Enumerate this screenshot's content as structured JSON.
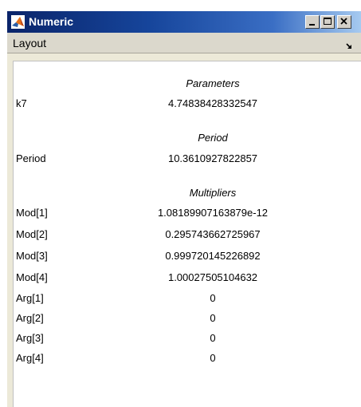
{
  "window": {
    "title": "Numeric"
  },
  "menu": {
    "layout_label": "Layout"
  },
  "sections": {
    "parameters": {
      "heading": "Parameters",
      "rows": [
        {
          "label": "k7",
          "value": "4.74838428332547"
        }
      ]
    },
    "period": {
      "heading": "Period",
      "rows": [
        {
          "label": "Period",
          "value": "10.3610927822857"
        }
      ]
    },
    "multipliers": {
      "heading": "Multipliers",
      "rows": [
        {
          "label": "Mod[1]",
          "value": "1.08189907163879e-12"
        },
        {
          "label": "Mod[2]",
          "value": "0.295743662725967"
        },
        {
          "label": "Mod[3]",
          "value": "0.999720145226892"
        },
        {
          "label": "Mod[4]",
          "value": "1.00027505104632"
        },
        {
          "label": "Arg[1]",
          "value": "0"
        },
        {
          "label": "Arg[2]",
          "value": "0"
        },
        {
          "label": "Arg[3]",
          "value": "0"
        },
        {
          "label": "Arg[4]",
          "value": "0"
        }
      ]
    }
  },
  "colors": {
    "titlebar_start": "#0a246a",
    "titlebar_end": "#a6caf0",
    "window_face": "#ece9d8",
    "content_bg": "#ffffff"
  },
  "icons": {
    "app": "matlab-logo-icon",
    "minimize": "minimize-icon",
    "maximize": "maximize-icon",
    "close": "close-icon",
    "menu_corner": "dock-arrow-icon"
  }
}
